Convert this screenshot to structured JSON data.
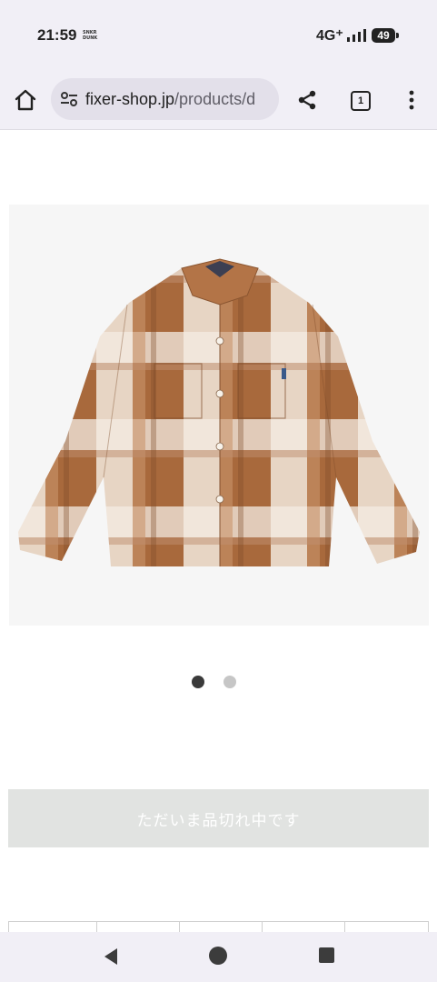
{
  "status_bar": {
    "time": "21:59",
    "notification_badge": "SNKR DUNK",
    "network": "4G⁺",
    "battery": "49"
  },
  "browser": {
    "url_domain": "fixer-shop.jp",
    "url_path": "/products/d",
    "tab_count": "1"
  },
  "product": {
    "image_description_icon": "flannel-shirt-image",
    "carousel": {
      "active_index": 0,
      "total": 2
    },
    "sold_out_label": "ただいま品切れ中です"
  },
  "colors": {
    "chrome_bg": "#f1eff6",
    "button_bg": "#e1e3e1",
    "shirt_brown": "#9a5f36",
    "shirt_cream": "#f4ece2"
  }
}
